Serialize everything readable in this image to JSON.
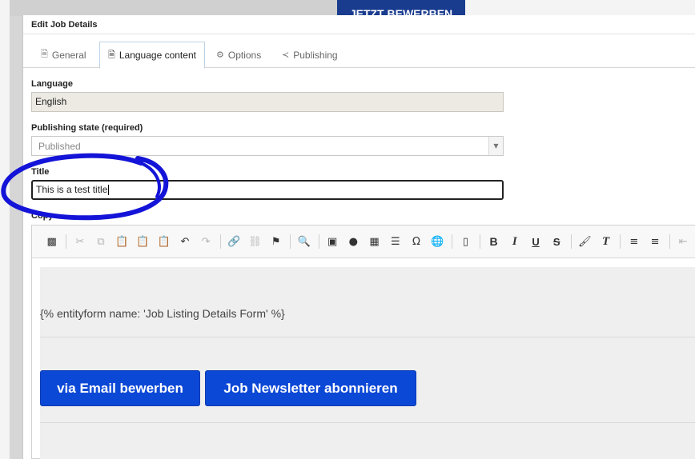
{
  "background": {
    "banner_text": "JETZT BEWERBEN",
    "banner_color": "#1a3c8f"
  },
  "modal": {
    "title": "Edit Job Details"
  },
  "tabs": [
    {
      "label": "General",
      "icon": "document-icon",
      "active": false
    },
    {
      "label": "Language content",
      "icon": "document-icon",
      "active": true
    },
    {
      "label": "Options",
      "icon": "gear-icon",
      "active": false
    },
    {
      "label": "Publishing",
      "icon": "share-icon",
      "active": false
    }
  ],
  "form": {
    "language": {
      "label": "Language",
      "value": "English"
    },
    "publishing_state": {
      "label": "Publishing state (required)",
      "value": "Published"
    },
    "title": {
      "label": "Title",
      "value": "This is a test title"
    },
    "copy": {
      "label": "Copy"
    }
  },
  "editor": {
    "toolbar_icons": [
      "source-icon",
      "cut-icon",
      "copy-icon",
      "paste-icon",
      "paste-text-icon",
      "paste-word-icon",
      "undo-icon",
      "redo-icon",
      "link-icon",
      "unlink-icon",
      "anchor-icon",
      "find-icon",
      "image-icon",
      "flash-icon",
      "table-icon",
      "horizontal-rule-icon",
      "special-char-icon",
      "iframe-icon",
      "page-break-icon",
      "bold-icon",
      "italic-icon",
      "underline-icon",
      "strike-icon",
      "format-painter-icon",
      "remove-format-icon",
      "numbered-list-icon",
      "bulleted-list-icon",
      "outdent-icon"
    ],
    "template_text": "{% entityform name: 'Job Listing Details Form' %}",
    "buttons": [
      "via Email bewerben",
      "Job Newsletter abonnieren"
    ],
    "button_color": "#0c48d6"
  },
  "annotation": {
    "color": "#1414d8",
    "shape": "hand-drawn-ellipse"
  }
}
